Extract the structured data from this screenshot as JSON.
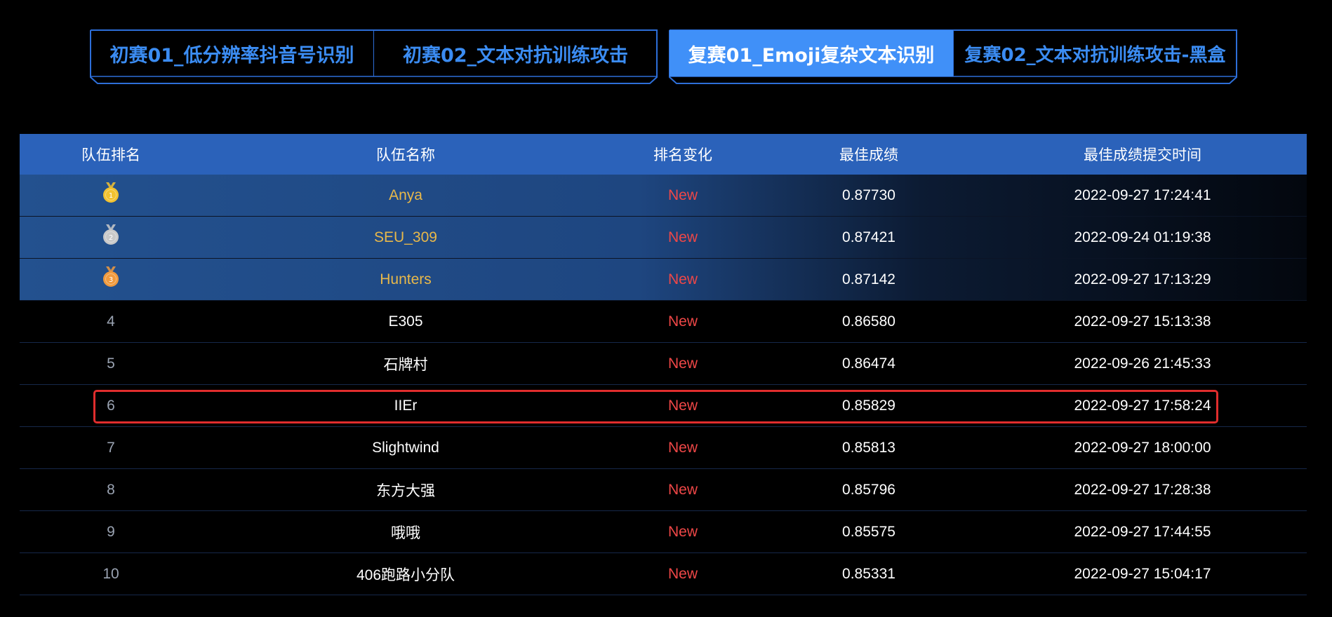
{
  "tabs_left": [
    {
      "label": "初赛01_低分辨率抖音号识别",
      "active": false
    },
    {
      "label": "初赛02_文本对抗训练攻击",
      "active": false
    }
  ],
  "tabs_right": [
    {
      "label": "复赛01_Emoji复杂文本识别",
      "active": true
    },
    {
      "label": "复赛02_文本对抗训练攻击-黑盒",
      "active": false
    }
  ],
  "table": {
    "headers": {
      "rank": "队伍排名",
      "team": "队伍名称",
      "change": "排名变化",
      "score": "最佳成绩",
      "time": "最佳成绩提交时间"
    },
    "rows": [
      {
        "rank": "1",
        "medal": "gold-medal-icon",
        "team": "Anya",
        "change": "New",
        "score": "0.87730",
        "time": "2022-09-27 17:24:41"
      },
      {
        "rank": "2",
        "medal": "silver-medal-icon",
        "team": "SEU_309",
        "change": "New",
        "score": "0.87421",
        "time": "2022-09-24 01:19:38"
      },
      {
        "rank": "3",
        "medal": "bronze-medal-icon",
        "team": "Hunters",
        "change": "New",
        "score": "0.87142",
        "time": "2022-09-27 17:13:29"
      },
      {
        "rank": "4",
        "team": "E305",
        "change": "New",
        "score": "0.86580",
        "time": "2022-09-27 15:13:38"
      },
      {
        "rank": "5",
        "team": "石牌村",
        "change": "New",
        "score": "0.86474",
        "time": "2022-09-26 21:45:33"
      },
      {
        "rank": "6",
        "team": "IIEr",
        "change": "New",
        "score": "0.85829",
        "time": "2022-09-27 17:58:24",
        "highlighted": true
      },
      {
        "rank": "7",
        "team": "Slightwind",
        "change": "New",
        "score": "0.85813",
        "time": "2022-09-27 18:00:00"
      },
      {
        "rank": "8",
        "team": "东方大强",
        "change": "New",
        "score": "0.85796",
        "time": "2022-09-27 17:28:38"
      },
      {
        "rank": "9",
        "team": "哦哦",
        "change": "New",
        "score": "0.85575",
        "time": "2022-09-27 17:44:55"
      },
      {
        "rank": "10",
        "team": "406跑路小分队",
        "change": "New",
        "score": "0.85331",
        "time": "2022-09-27 15:04:17"
      }
    ]
  },
  "colors": {
    "background": "#000000",
    "header_bg": "#2b62ba",
    "tab_text": "#3b8cf2",
    "tab_active_bg": "#4090f8",
    "medal_gold": "#f2c230",
    "medal_silver": "#c9c9c9",
    "medal_bronze": "#f09a3e",
    "top_team_text": "#e8b84a",
    "change_text": "#ef4747",
    "highlight_border": "#e02d2d"
  }
}
